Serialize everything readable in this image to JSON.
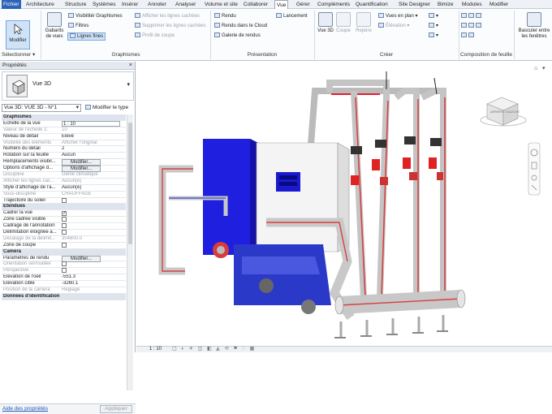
{
  "menu": {
    "file": "Fichier",
    "tabs": [
      "Architecture",
      "Structure",
      "Systèmes",
      "Insérer",
      "Annoter",
      "Analyser",
      "Volume et site",
      "Collaborer",
      "Vue",
      "Gérer",
      "Compléments",
      "Quantification",
      "Site Designer",
      "Bimize",
      "Modules",
      "Modifier"
    ]
  },
  "ribbon": {
    "modify": "Modifier",
    "select": "Sélectionner ▾",
    "templates": "Gabarits de vues",
    "visibility": "Visibilité/ Graphismes",
    "filters": "Filtres",
    "thin_lines": "Lignes fines",
    "show_hidden": "Afficher les lignes cachées",
    "remove_hidden": "Supprimer les lignes cachées",
    "cut_profile": "Profil de coupe",
    "graphics_label": "Graphismes",
    "render": "Rendu",
    "render_cloud": "Rendu dans le Cloud",
    "gallery": "Galerie de rendus",
    "launch": "Lancement",
    "presentation_label": "Présentation",
    "view3d": "Vue 3D",
    "section": "Coupe",
    "callout": "Repère",
    "plan_views": "Vues en plan",
    "elevation": "Élévation",
    "create_label": "Créer",
    "sheet_comp_label": "Composition de feuille",
    "switch": "Basculer entre les fenêtres"
  },
  "properties": {
    "title": "Propriétés",
    "type_name": "Vue 3D",
    "instance": "Vue 3D: VUE 3D - N°1",
    "edit_type": "Modifier le type",
    "rows": [
      {
        "kind": "sec",
        "label": "Graphismes"
      },
      {
        "label": "Echelle de la vue",
        "value": "1 : 10",
        "box": true
      },
      {
        "label": "Valeur de l'échelle   1:",
        "value": "10",
        "dis": true
      },
      {
        "label": "Niveau de détail",
        "value": "Elevé"
      },
      {
        "label": "Visibilité des éléments",
        "value": "Afficher l'original",
        "dis": true
      },
      {
        "label": "Numéro du détail",
        "value": "2"
      },
      {
        "label": "Rotation sur la feuille",
        "value": "Aucun"
      },
      {
        "label": "Remplacements visibil...",
        "btn": "Modifier..."
      },
      {
        "label": "Options d'affichage d...",
        "btn": "Modifier..."
      },
      {
        "label": "Discipline",
        "value": "Génie climatique",
        "dis": true
      },
      {
        "label": "Afficher les lignes cac...",
        "value": "Aucun(e)",
        "dis": true
      },
      {
        "label": "Style d'affichage de l'a...",
        "value": "Aucun(e)"
      },
      {
        "label": "Sous-discipline",
        "value": "CHAUFFAGE",
        "dis": true
      },
      {
        "label": "Trajectoire du soleil",
        "check": false
      },
      {
        "kind": "sec",
        "label": "Etendues"
      },
      {
        "label": "Cadrer la vue",
        "check": true
      },
      {
        "label": "Zone cadrée visible",
        "check": false
      },
      {
        "label": "Cadrage de l'annotation",
        "check": false
      },
      {
        "label": "Délimitation éloignée a...",
        "check": false
      },
      {
        "label": "Décalage de la délimit...",
        "value": "304800.0",
        "dis": true
      },
      {
        "label": "Zone de coupe",
        "check": false
      },
      {
        "kind": "sec",
        "label": "Caméra"
      },
      {
        "label": "Paramètres de rendu",
        "btn": "Modifier..."
      },
      {
        "label": "Orientation verrouillée",
        "check": false,
        "dis": true
      },
      {
        "label": "Perspective",
        "check": false,
        "dis": true
      },
      {
        "label": "Elévation de l'oeil",
        "value": "-551.3"
      },
      {
        "label": "Elévation cible",
        "value": "-3260.1"
      },
      {
        "label": "Position de la caméra",
        "value": "Réglage",
        "dis": true
      },
      {
        "kind": "sec",
        "label": "Données d'identification"
      }
    ],
    "help": "Aide des propriétés",
    "apply": "Appliquer"
  },
  "viewport": {
    "scale": "1 : 10",
    "cube_label": "ARRIÈRE GAUCHE",
    "colors": {
      "pipe": "#c9c9c9",
      "pipe_red": "#d64040",
      "tank": "#1f1fe0",
      "box": "#f4f4f4",
      "valve_red": "#e02222",
      "equip_blue": "#2b39c8"
    }
  }
}
